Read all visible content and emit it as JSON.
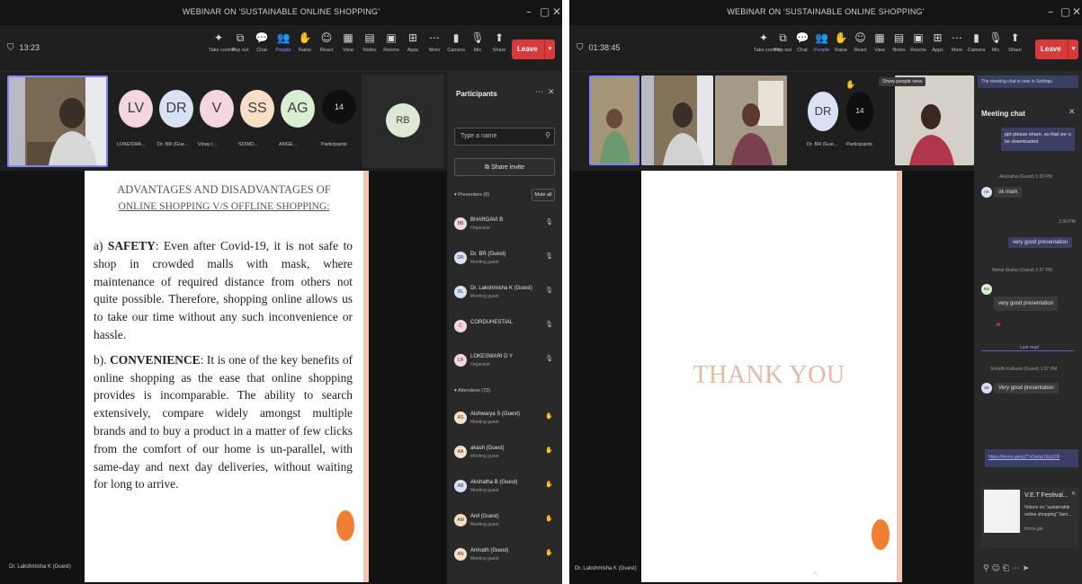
{
  "window_title": "WEBINAR ON 'SUSTAINABLE ONLINE SHOPPING'",
  "window_controls": {
    "minimize": "–",
    "maximize": "▢",
    "close": "✕"
  },
  "left": {
    "timer": "13:23",
    "toolbar": [
      {
        "icon": "sparkle-icon",
        "glyph": "✦",
        "label": "Take control"
      },
      {
        "icon": "pop-out-icon",
        "glyph": "⧉",
        "label": "Pop out"
      },
      {
        "icon": "chat-icon",
        "glyph": "💬",
        "label": "Chat"
      },
      {
        "icon": "people-icon",
        "glyph": "👥",
        "label": "People"
      },
      {
        "icon": "raise-hand-icon",
        "glyph": "✋",
        "label": "Raise"
      },
      {
        "icon": "react-icon",
        "glyph": "☺",
        "label": "React"
      },
      {
        "icon": "view-icon",
        "glyph": "▦",
        "label": "View"
      },
      {
        "icon": "notes-icon",
        "glyph": "▤",
        "label": "Notes"
      },
      {
        "icon": "whiteboard-icon",
        "glyph": "▣",
        "label": "Rooms"
      },
      {
        "icon": "apps-icon",
        "glyph": "⊞",
        "label": "Apps"
      },
      {
        "icon": "more-icon",
        "glyph": "⋯",
        "label": "More"
      },
      {
        "icon": "camera-icon",
        "glyph": "▮",
        "label": "Camera"
      },
      {
        "icon": "mic-icon",
        "glyph": "🎙",
        "label": "Mic"
      },
      {
        "icon": "share-icon",
        "glyph": "⬆",
        "label": "Share"
      }
    ],
    "leave_label": "Leave",
    "participants_strip": [
      {
        "initials": "LV",
        "color": "#f4d6e0",
        "label": "LOKESWA..."
      },
      {
        "initials": "DR",
        "color": "#d8e2f4",
        "label": "Dr. BR (Gue..."
      },
      {
        "initials": "V",
        "color": "#f4d6e0",
        "label": "Vinay (..."
      },
      {
        "initials": "SS",
        "color": "#f6dfc6",
        "label": "SOWD..."
      },
      {
        "initials": "AG",
        "color": "#dbeed2",
        "label": "ANGE..."
      }
    ],
    "more_count": "14",
    "more_label": "Participants",
    "extra_avatar": "RB",
    "slide": {
      "title_line1": "ADVANTAGES AND DISADVANTAGES OF",
      "title_line2": "ONLINE SHOPPING V/S OFFLINE SHOPPING:",
      "para_a_prefix": "a) ",
      "para_a_head": "SAFETY",
      "para_a_body": ": Even after Covid-19, it is not safe to shop in crowded malls with mask, where maintenance of required distance from others not quite possible. Therefore, shopping online allows us to take our time without any such inconvenience or hassle.",
      "para_b_prefix": "b). ",
      "para_b_head": "CONVENIENCE",
      "para_b_body": ": It is one of the key benefits of online shopping as the ease that online shopping provides is incomparable.  The ability to search extensively, compare widely amongst multiple brands and to buy a product in a matter of few clicks from the comfort of our home is un-parallel, with same-day and next day deliveries, without waiting for long to arrive."
    },
    "presenter_tag": "Dr. Lakshmisha K (Guest)",
    "panel": {
      "title": "Participants",
      "search_placeholder": "Type a name",
      "share_invite": "Share invite",
      "presenters_header": "Presenters (6)",
      "mute_all": "Mute all",
      "presenters": [
        {
          "initials": "BB",
          "color": "#f4d6e0",
          "name": "BHARGAVI B",
          "role": "Organizer"
        },
        {
          "initials": "DR",
          "color": "#d8e2f4",
          "name": "Dr. BR (Guest)",
          "role": "Meeting guest"
        },
        {
          "initials": "DL",
          "color": "#d8e2f4",
          "name": "Dr. Lakshmisha K (Guest)",
          "role": "Meeting guest"
        },
        {
          "initials": "C",
          "color": "#f4d6e0",
          "name": "CORDUHESTIAL",
          "role": ""
        },
        {
          "initials": "LR",
          "color": "#f4d6e0",
          "name": "LOKESWARI D Y",
          "role": "Organizer"
        }
      ],
      "attendees_header": "Attendees (73)",
      "attendees": [
        {
          "initials": "AS",
          "color": "#f6dfc6",
          "name": "Aishwarya S (Guest)",
          "role": "Meeting guest"
        },
        {
          "initials": "AA",
          "color": "#f6dfc6",
          "name": "akash (Guest)",
          "role": "Meeting guest"
        },
        {
          "initials": "AB",
          "color": "#d8e2f4",
          "name": "Akshatha B (Guest)",
          "role": "Meeting guest"
        },
        {
          "initials": "AM",
          "color": "#f6dfc6",
          "name": "Anil (Guest)",
          "role": "Meeting guest"
        },
        {
          "initials": "AN",
          "color": "#f6dfc6",
          "name": "Anirudh (Guest)",
          "role": "Meeting guest"
        }
      ]
    }
  },
  "right": {
    "timer": "01:38:45",
    "toolbar": [
      {
        "icon": "sparkle-icon",
        "glyph": "✦",
        "label": "Take control"
      },
      {
        "icon": "pop-out-icon",
        "glyph": "⧉",
        "label": "Pop out"
      },
      {
        "icon": "chat-icon",
        "glyph": "💬",
        "label": "Chat"
      },
      {
        "icon": "people-icon",
        "glyph": "👥",
        "label": "People"
      },
      {
        "icon": "raise-hand-icon",
        "glyph": "✋",
        "label": "Raise"
      },
      {
        "icon": "react-icon",
        "glyph": "☺",
        "label": "React"
      },
      {
        "icon": "view-icon",
        "glyph": "▦",
        "label": "View"
      },
      {
        "icon": "notes-icon",
        "glyph": "▤",
        "label": "Notes"
      },
      {
        "icon": "whiteboard-icon",
        "glyph": "▣",
        "label": "Rooms"
      },
      {
        "icon": "apps-icon",
        "glyph": "⊞",
        "label": "Apps"
      },
      {
        "icon": "more-icon",
        "glyph": "⋯",
        "label": "More"
      },
      {
        "icon": "camera-icon",
        "glyph": "▮",
        "label": "Camera"
      },
      {
        "icon": "mic-icon",
        "glyph": "🎙",
        "label": "Mic"
      },
      {
        "icon": "share-icon",
        "glyph": "⬆",
        "label": "Share"
      }
    ],
    "leave_label": "Leave",
    "dr_avatar": "DR",
    "dr_label": "Dr. BR (Gue...",
    "more_count": "14",
    "more_label": "Participants",
    "tooltip": "Show people view",
    "slide_text": "THANK YOU",
    "presenter_tag": "Dr. Lakshmisha K (Guest)",
    "chat": {
      "banner": "The meeting chat is now in Settings",
      "title": "Meeting chat",
      "top_msg_1": "ppt please share, so that we can",
      "top_msg_2": "be downloaded",
      "m1_meta": "Akshatha (Guest)  1:30 PM",
      "m1_text": "ok mam",
      "m2_meta": "1:30 PM",
      "m2_text": "very good presentation",
      "m3_meta": "Nehal Sneha (Guest)  1:37 PM",
      "m3_text": "very good presentation",
      "last_read": "Last read",
      "m4_meta": "Srinidhi Kulkarni (Guest)  1:37 PM",
      "m4_text": "Very good presentation",
      "link_text": "https://forms.gle/yZTvDwbp1Eq1ZR",
      "card_title": "V.E.T Festival...",
      "card_sub1": "Videos on \"sustainable",
      "card_sub2": "online shopping\" Sam...",
      "card_sub3": "forms.gle",
      "compose_icons": "⚲  ☺  ⎗  ⋯  ➤"
    }
  }
}
